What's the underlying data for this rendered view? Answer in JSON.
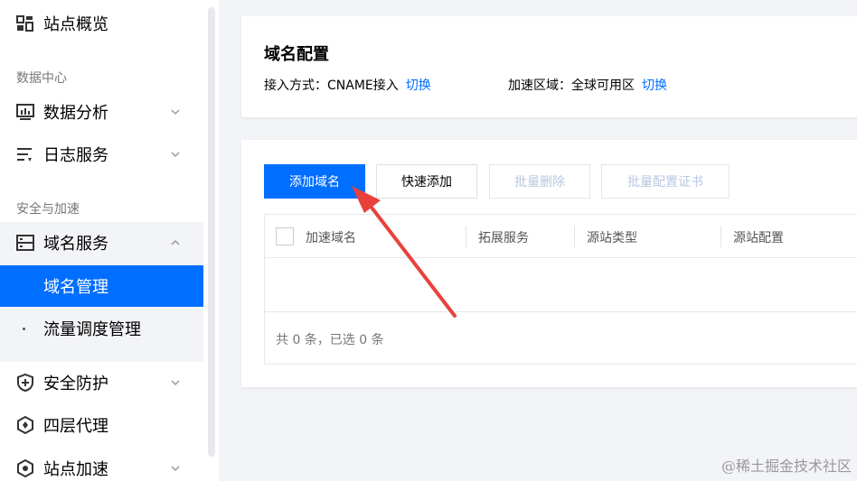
{
  "sidebar": {
    "overview": "站点概览",
    "section_data": "数据中心",
    "data_analysis": "数据分析",
    "log_service": "日志服务",
    "section_security": "安全与加速",
    "domain_service": "域名服务",
    "domain_manage": "域名管理",
    "traffic_schedule": "流量调度管理",
    "security_protect": "安全防护",
    "layer4_proxy": "四层代理",
    "site_accel": "站点加速"
  },
  "config": {
    "title": "域名配置",
    "access_label": "接入方式：",
    "access_value": "CNAME接入",
    "access_switch": "切换",
    "region_label": "加速区域：",
    "region_value": "全球可用区",
    "region_switch": "切换"
  },
  "toolbar": {
    "add": "添加域名",
    "quick_add": "快速添加",
    "batch_delete": "批量删除",
    "batch_cert": "批量配置证书"
  },
  "table": {
    "columns": [
      "加速域名",
      "拓展服务",
      "源站类型",
      "源站配置"
    ],
    "footer": "共 0 条，已选 0 条"
  },
  "watermark": "@稀土掘金技术社区",
  "colors": {
    "accent": "#006eff",
    "annotation": "#e8413c"
  }
}
